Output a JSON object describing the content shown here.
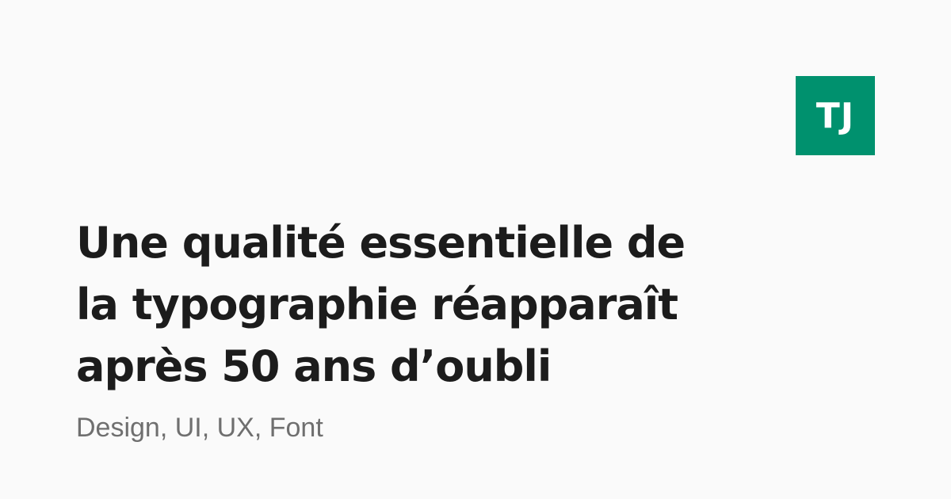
{
  "logo": {
    "text": "TJ",
    "background_color": "#00916e",
    "text_color": "#ffffff"
  },
  "headline": {
    "lines": [
      "Une qualité essentielle de",
      "la typographie réapparaît",
      "après 50 ans d’oubli"
    ],
    "color": "#1c1c1c"
  },
  "tags": {
    "text": "Design, UI, UX, Font",
    "color": "#6f6f6f"
  },
  "page": {
    "background_color": "#fafafa"
  }
}
